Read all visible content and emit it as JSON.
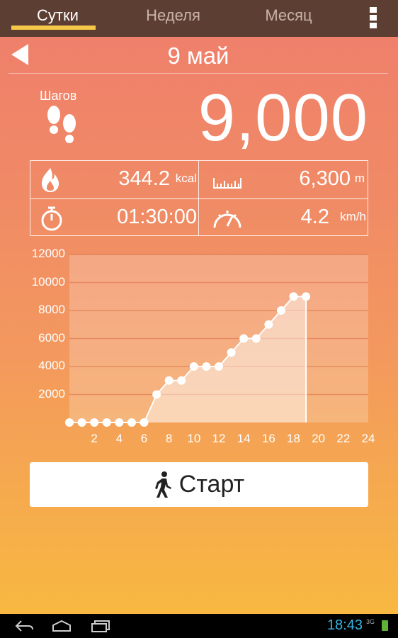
{
  "tabs": [
    {
      "label": "Сутки",
      "active": true
    },
    {
      "label": "Неделя",
      "active": false
    },
    {
      "label": "Месяц",
      "active": false
    }
  ],
  "header": {
    "date": "9 май"
  },
  "steps": {
    "label": "Шагов",
    "value": "9,000"
  },
  "stats": {
    "calories": {
      "value": "344.2",
      "unit": "kcal",
      "icon": "flame-icon"
    },
    "distance": {
      "value": "6,300",
      "unit": "m",
      "icon": "ruler-icon"
    },
    "duration": {
      "value": "01:30:00",
      "icon": "stopwatch-icon"
    },
    "speed": {
      "value": "4.2",
      "unit": "km/h",
      "icon": "speedometer-icon"
    }
  },
  "start_button": {
    "label": "Старт"
  },
  "status_bar": {
    "time": "18:43",
    "network": "3G"
  },
  "colors": {
    "tabbar": "#5d3e33",
    "accent": "#f5c84a",
    "time": "#33b5e5"
  },
  "chart_data": {
    "type": "area",
    "x": [
      0,
      1,
      2,
      3,
      4,
      5,
      6,
      7,
      8,
      9,
      10,
      11,
      12,
      13,
      14,
      15,
      16,
      17,
      18,
      19
    ],
    "values": [
      0,
      0,
      0,
      0,
      0,
      0,
      0,
      2000,
      3000,
      3000,
      4000,
      4000,
      4000,
      5000,
      6000,
      6000,
      7000,
      8000,
      9000,
      9000
    ],
    "ytick_labels": [
      "2000",
      "4000",
      "6000",
      "8000",
      "10000",
      "12000"
    ],
    "xtick_labels": [
      "2",
      "4",
      "6",
      "8",
      "10",
      "12",
      "14",
      "16",
      "18",
      "20",
      "22",
      "24"
    ],
    "xlim": [
      0,
      24
    ],
    "ylim": [
      0,
      12000
    ],
    "grid": true
  }
}
